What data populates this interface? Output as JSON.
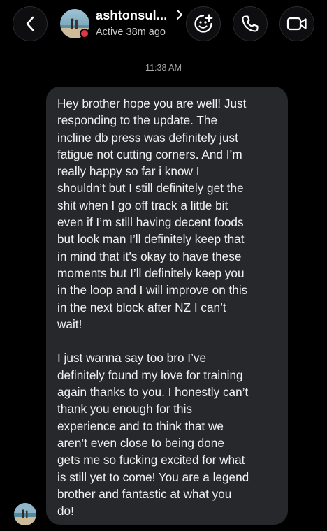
{
  "header": {
    "back_icon": "chevron-left-icon",
    "username": "ashtonsul...",
    "username_chevron_icon": "chevron-right-icon",
    "status": "Active 38m ago",
    "sticker_icon": "sticker-plus-icon",
    "call_icon": "phone-icon",
    "video_icon": "video-camera-icon"
  },
  "thread": {
    "timestamp": "11:38 AM",
    "message": {
      "paragraph_1": "Hey brother hope you are well! Just\nresponding to the update. The\nincline db press was definitely just\nfatigue not cutting corners. And I’m\nreally happy so far i know I\nshouldn’t but I still definitely get the\nshit when I go off track a little bit\neven if I’m still having decent foods\nbut look man I’ll definitely keep that\nin mind that it’s okay to have these\nmoments but I’ll definitely keep you\nin the loop and I will improve on this\nin the next block after NZ I can’t\nwait!",
      "paragraph_2": "I just wanna say too bro I’ve\ndefinitely found my love for training\nagain thanks to you. I honestly can’t\nthank you enough for this\nexperience and to think that we\naren’t even close to being done\ngets me so fucking excited for what\nis still yet to come! You are a legend\nbrother and fantastic at what you\ndo!"
    }
  },
  "colors": {
    "background": "#000000",
    "bubble": "#26282c",
    "text": "#f2f2f2",
    "muted": "#a8a8a8",
    "online_dot": "#e0364a"
  }
}
